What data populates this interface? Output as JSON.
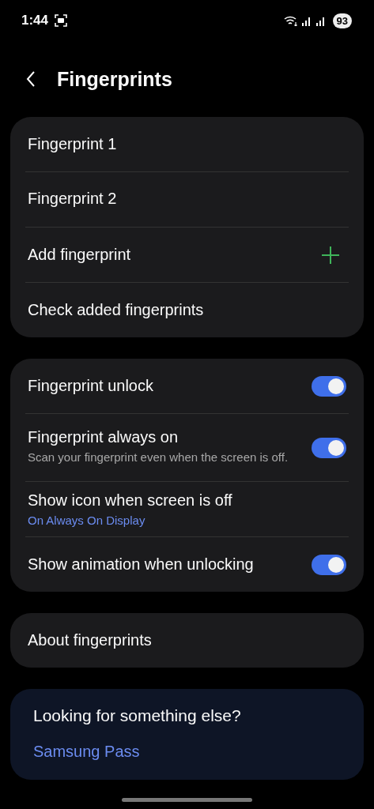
{
  "status_bar": {
    "time": "1:44",
    "battery": "93"
  },
  "header": {
    "title": "Fingerprints"
  },
  "cards": [
    {
      "items": [
        {
          "kind": "link",
          "title": "Fingerprint 1"
        },
        {
          "kind": "link",
          "title": "Fingerprint 2"
        },
        {
          "kind": "add",
          "title": "Add fingerprint"
        },
        {
          "kind": "link",
          "title": "Check added fingerprints"
        }
      ]
    },
    {
      "items": [
        {
          "kind": "toggle",
          "title": "Fingerprint unlock",
          "on": true
        },
        {
          "kind": "toggle",
          "title": "Fingerprint always on",
          "summary": "Scan your fingerprint even when the screen is off.",
          "on": true
        },
        {
          "kind": "link",
          "title": "Show icon when screen is off",
          "status": "On Always On Display"
        },
        {
          "kind": "toggle",
          "title": "Show animation when unlocking",
          "on": true
        }
      ]
    },
    {
      "items": [
        {
          "kind": "link",
          "title": "About fingerprints"
        }
      ]
    }
  ],
  "suggestions": {
    "title": "Looking for something else?",
    "links": [
      "Samsung Pass"
    ]
  }
}
